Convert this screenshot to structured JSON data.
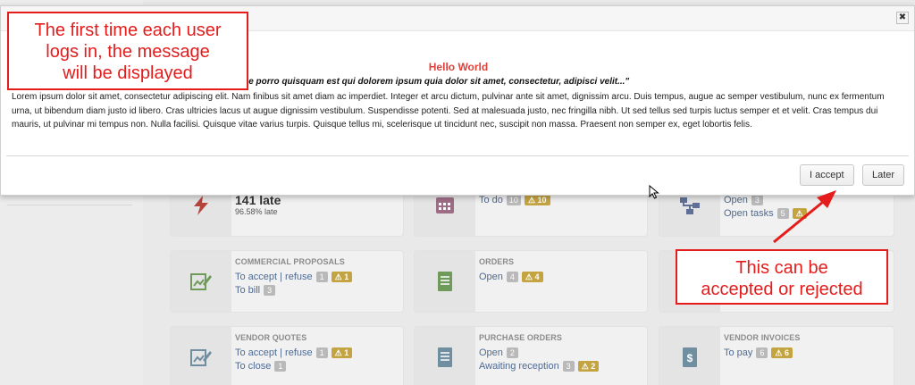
{
  "modal": {
    "title": "Hello World",
    "quote": "que porro quisquam est qui dolorem ipsum quia dolor sit amet, consectetur, adipisci velit...\"",
    "body": "Lorem ipsum dolor sit amet, consectetur adipiscing elit. Nam finibus sit amet diam ac imperdiet. Integer et arcu dictum, pulvinar ante sit amet, dignissim arcu. Duis tempus, augue ac semper vestibulum, nunc ex fermentum urna, ut bibendum diam justo id libero. Cras ultricies lacus ut augue dignissim vestibulum. Suspendisse potenti. Sed at malesuada justo, nec fringilla nibh. Ut sed tellus sed turpis luctus semper et et velit. Cras tempus dui mauris, ut pulvinar mi tempus non. Nulla facilisi. Quisque vitae varius turpis. Quisque tellus mi, scelerisque ut tincidunt nec, suscipit non massa. Praesent non semper ex, eget lobortis felis.",
    "close_glyph": "✖",
    "accept_label": "I accept",
    "later_label": "Later"
  },
  "annotations": {
    "top_left": [
      "The first time each user",
      "logs in, the message",
      "will be displayed"
    ],
    "bottom_right": [
      "This can be",
      "accepted or rejected"
    ]
  },
  "dashboard": {
    "late_card": {
      "count": "141 late",
      "pct": "96.58% late"
    },
    "todo_card": {
      "label": "To do",
      "badge": "10",
      "warn": "10"
    },
    "open_card": {
      "open_label": "Open",
      "open_badge": "3",
      "open_tasks_label": "Open tasks",
      "open_tasks_badge": "5",
      "open_tasks_warn": ""
    },
    "commercial": {
      "title": "COMMERCIAL PROPOSALS",
      "line1": "To accept | refuse",
      "line1_badge": "1",
      "line1_warn": "1",
      "line2": "To bill",
      "line2_badge": "3"
    },
    "orders": {
      "title": "ORDERS",
      "line1": "Open",
      "line1_badge": "4",
      "line1_warn": "4"
    },
    "vendor_quotes": {
      "title": "VENDOR QUOTES",
      "line1": "To accept | refuse",
      "line1_badge": "1",
      "line1_warn": "1",
      "line2": "To close",
      "line2_badge": "1"
    },
    "purchase_orders": {
      "title": "PURCHASE ORDERS",
      "line1": "Open",
      "line1_badge": "2",
      "line2": "Awaiting reception",
      "line2_badge": "3",
      "line2_warn": "2"
    },
    "vendor_invoices": {
      "title": "VENDOR INVOICES",
      "line1": "To pay",
      "line1_badge": "6",
      "line1_warn": "6"
    }
  },
  "colors": {
    "accent_red": "#e41c1c",
    "title_red": "#e0423b",
    "link_blue": "#4f6a93",
    "warn_gold": "#c4a341"
  }
}
